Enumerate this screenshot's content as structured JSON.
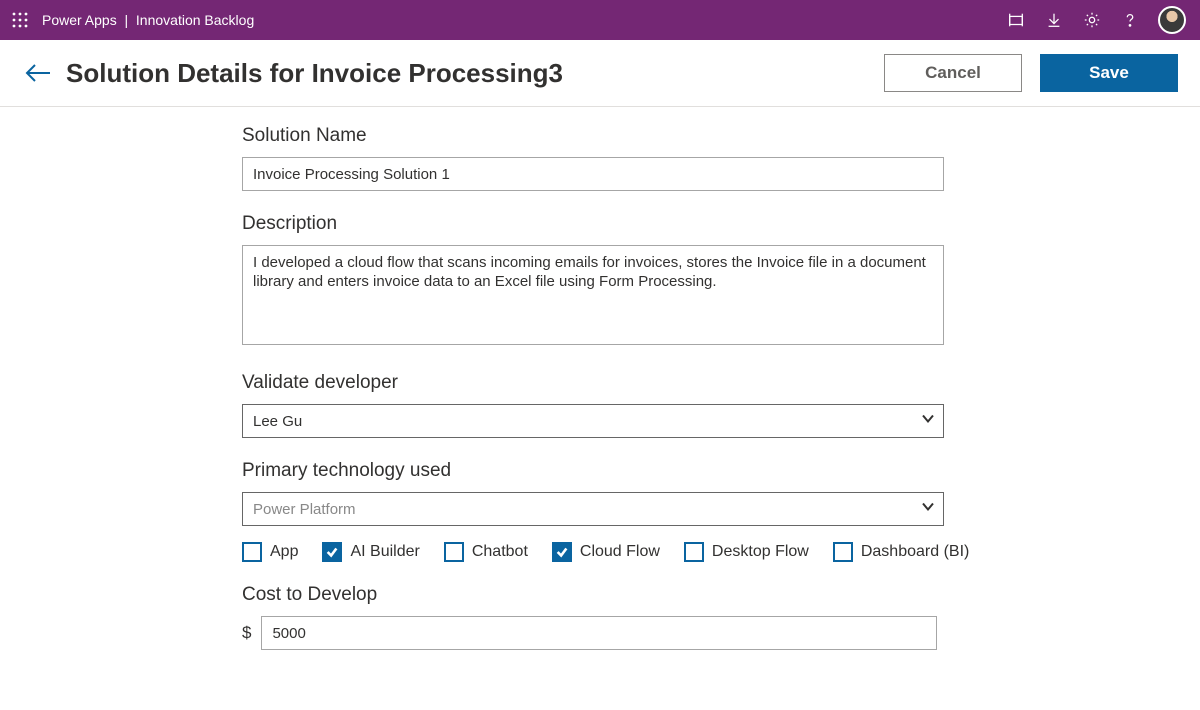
{
  "topbar": {
    "app_name": "Power Apps",
    "separator": "  |  ",
    "context": "Innovation Backlog"
  },
  "header": {
    "title": "Solution Details for Invoice Processing3",
    "cancel_label": "Cancel",
    "save_label": "Save"
  },
  "form": {
    "solution_name": {
      "label": "Solution Name",
      "value": "Invoice Processing Solution 1"
    },
    "description": {
      "label": "Description",
      "value": "I developed a cloud flow that scans incoming emails for invoices, stores the Invoice file in a document library and enters invoice data to an Excel file using Form Processing."
    },
    "validate_developer": {
      "label": "Validate developer",
      "value": "Lee Gu"
    },
    "primary_tech": {
      "label": "Primary technology used",
      "value": "Power Platform"
    },
    "checkboxes": [
      {
        "label": "App",
        "checked": false
      },
      {
        "label": "AI Builder",
        "checked": true
      },
      {
        "label": "Chatbot",
        "checked": false
      },
      {
        "label": "Cloud Flow",
        "checked": true
      },
      {
        "label": "Desktop Flow",
        "checked": false
      },
      {
        "label": "Dashboard (BI)",
        "checked": false
      }
    ],
    "cost": {
      "label": "Cost to Develop",
      "currency": "$",
      "value": "5000"
    }
  }
}
